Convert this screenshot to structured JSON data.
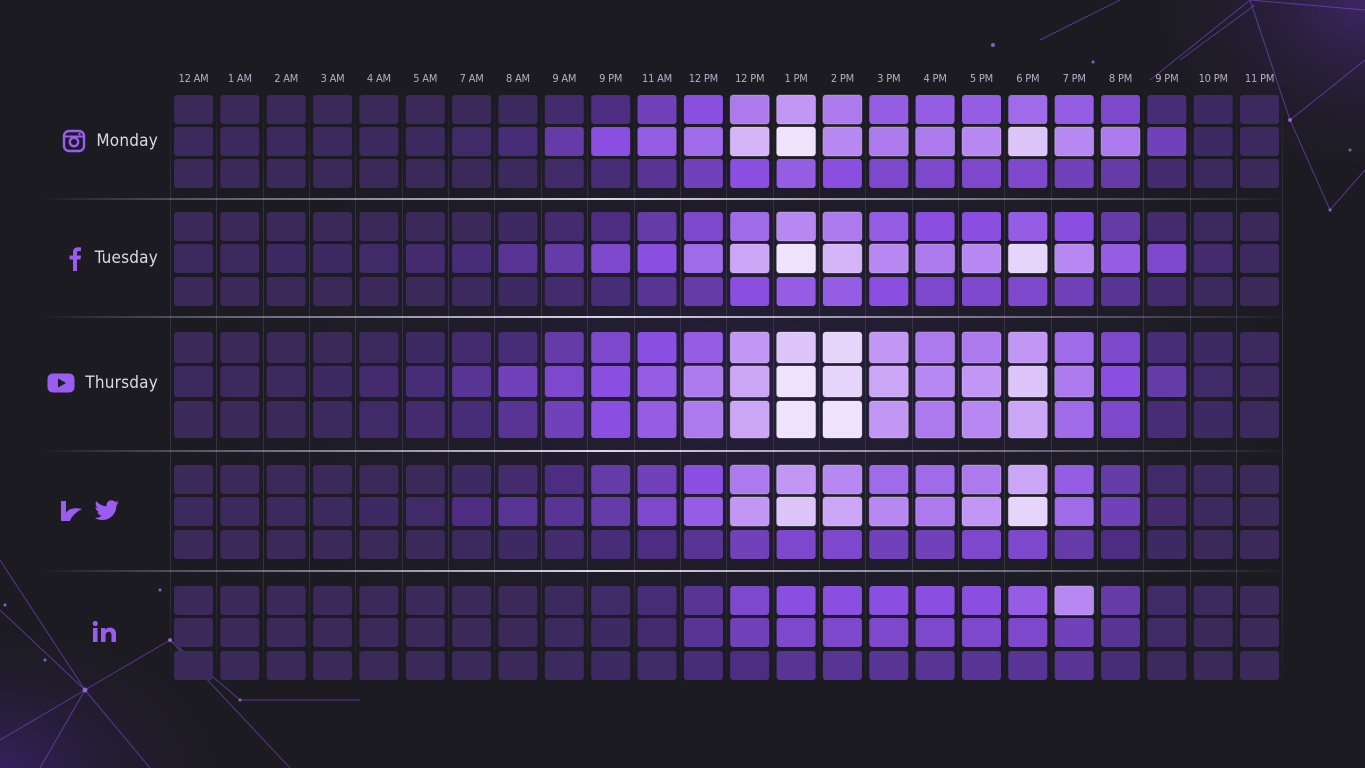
{
  "hours": [
    "12 AM",
    "1 AM",
    "2 AM",
    "3 AM",
    "4 AM",
    "5 AM",
    "7 AM",
    "8 AM",
    "9 AM",
    "9 PM",
    "11 AM",
    "12 PM",
    "12 PM",
    "1 PM",
    "2 PM",
    "3 PM",
    "4 PM",
    "5 PM",
    "6 PM",
    "7 PM",
    "8 PM",
    "9 PM",
    "10 PM",
    "11 PM"
  ],
  "rows": [
    {
      "day": "Monday",
      "icons": [
        "instagram-icon"
      ]
    },
    {
      "day": "Tuesday",
      "icons": [
        "facebook-icon"
      ]
    },
    {
      "day": "Thursday",
      "icons": [
        "youtube-icon"
      ]
    },
    {
      "day": "",
      "icons": [
        "unknown-brand-icon",
        "twitter-icon"
      ]
    },
    {
      "day": "",
      "icons": [
        "linkedin-icon"
      ]
    }
  ],
  "colors": {
    "accent": "#8a4fe0",
    "background": "#1c1b21",
    "cell_low": "#3a2a57",
    "cell_high": "#efe3fb"
  },
  "chart_data": {
    "type": "heatmap",
    "x_categories": [
      "12 AM",
      "1 AM",
      "2 AM",
      "3 AM",
      "4 AM",
      "5 AM",
      "7 AM",
      "8 AM",
      "9 AM",
      "9 PM",
      "11 AM",
      "12 PM",
      "12 PM",
      "1 PM",
      "2 PM",
      "3 PM",
      "4 PM",
      "5 PM",
      "6 PM",
      "7 PM",
      "8 PM",
      "9 PM",
      "10 PM",
      "11 PM"
    ],
    "groups": [
      {
        "label": "Monday",
        "values": [
          [
            0.05,
            0.05,
            0.05,
            0.05,
            0.05,
            0.05,
            0.05,
            0.08,
            0.15,
            0.25,
            0.4,
            0.5,
            0.65,
            0.75,
            0.65,
            0.55,
            0.55,
            0.55,
            0.6,
            0.55,
            0.45,
            0.2,
            0.1,
            0.08
          ],
          [
            0.08,
            0.08,
            0.08,
            0.08,
            0.08,
            0.08,
            0.12,
            0.2,
            0.35,
            0.5,
            0.55,
            0.6,
            0.85,
            1.0,
            0.7,
            0.65,
            0.65,
            0.7,
            0.9,
            0.7,
            0.65,
            0.4,
            0.1,
            0.08
          ],
          [
            0.05,
            0.05,
            0.05,
            0.05,
            0.05,
            0.05,
            0.05,
            0.08,
            0.12,
            0.2,
            0.3,
            0.4,
            0.5,
            0.55,
            0.5,
            0.45,
            0.45,
            0.45,
            0.45,
            0.4,
            0.35,
            0.15,
            0.08,
            0.05
          ]
        ]
      },
      {
        "label": "Tuesday",
        "values": [
          [
            0.05,
            0.05,
            0.05,
            0.05,
            0.05,
            0.05,
            0.05,
            0.1,
            0.15,
            0.25,
            0.35,
            0.45,
            0.6,
            0.7,
            0.65,
            0.55,
            0.5,
            0.5,
            0.55,
            0.5,
            0.35,
            0.15,
            0.08,
            0.05
          ],
          [
            0.08,
            0.08,
            0.1,
            0.1,
            0.12,
            0.15,
            0.2,
            0.3,
            0.35,
            0.45,
            0.5,
            0.6,
            0.8,
            1.0,
            0.85,
            0.7,
            0.65,
            0.7,
            0.95,
            0.7,
            0.55,
            0.45,
            0.15,
            0.08
          ],
          [
            0.05,
            0.05,
            0.05,
            0.05,
            0.05,
            0.05,
            0.08,
            0.1,
            0.15,
            0.2,
            0.3,
            0.35,
            0.5,
            0.55,
            0.55,
            0.5,
            0.45,
            0.45,
            0.45,
            0.4,
            0.3,
            0.15,
            0.08,
            0.05
          ]
        ]
      },
      {
        "label": "Thursday",
        "values": [
          [
            0.05,
            0.05,
            0.05,
            0.05,
            0.08,
            0.1,
            0.15,
            0.2,
            0.35,
            0.45,
            0.5,
            0.55,
            0.75,
            0.9,
            0.95,
            0.75,
            0.65,
            0.65,
            0.75,
            0.6,
            0.45,
            0.2,
            0.1,
            0.08
          ],
          [
            0.08,
            0.08,
            0.08,
            0.1,
            0.15,
            0.2,
            0.3,
            0.4,
            0.45,
            0.5,
            0.55,
            0.65,
            0.8,
            1.0,
            0.95,
            0.8,
            0.7,
            0.75,
            0.9,
            0.65,
            0.5,
            0.35,
            0.12,
            0.08
          ],
          [
            0.05,
            0.05,
            0.05,
            0.08,
            0.12,
            0.15,
            0.2,
            0.3,
            0.4,
            0.5,
            0.55,
            0.65,
            0.8,
            1.0,
            1.0,
            0.75,
            0.65,
            0.7,
            0.8,
            0.6,
            0.45,
            0.2,
            0.1,
            0.08
          ]
        ]
      },
      {
        "label": "",
        "values": [
          [
            0.05,
            0.05,
            0.05,
            0.05,
            0.05,
            0.05,
            0.1,
            0.15,
            0.25,
            0.35,
            0.4,
            0.5,
            0.65,
            0.75,
            0.7,
            0.6,
            0.6,
            0.65,
            0.8,
            0.55,
            0.35,
            0.12,
            0.08,
            0.05
          ],
          [
            0.08,
            0.08,
            0.08,
            0.08,
            0.1,
            0.12,
            0.25,
            0.3,
            0.3,
            0.35,
            0.45,
            0.55,
            0.75,
            0.9,
            0.8,
            0.7,
            0.65,
            0.75,
            0.95,
            0.6,
            0.4,
            0.15,
            0.08,
            0.05
          ],
          [
            0.05,
            0.05,
            0.05,
            0.05,
            0.05,
            0.05,
            0.08,
            0.1,
            0.15,
            0.2,
            0.25,
            0.3,
            0.4,
            0.45,
            0.45,
            0.4,
            0.4,
            0.45,
            0.45,
            0.35,
            0.25,
            0.1,
            0.05,
            0.05
          ]
        ]
      },
      {
        "label": "",
        "values": [
          [
            0.05,
            0.05,
            0.05,
            0.05,
            0.05,
            0.05,
            0.05,
            0.05,
            0.08,
            0.12,
            0.2,
            0.3,
            0.45,
            0.5,
            0.5,
            0.5,
            0.5,
            0.5,
            0.55,
            0.7,
            0.35,
            0.12,
            0.08,
            0.05
          ],
          [
            0.05,
            0.05,
            0.05,
            0.05,
            0.05,
            0.05,
            0.05,
            0.05,
            0.08,
            0.1,
            0.15,
            0.3,
            0.4,
            0.45,
            0.45,
            0.45,
            0.45,
            0.45,
            0.45,
            0.4,
            0.3,
            0.12,
            0.05,
            0.05
          ],
          [
            0.05,
            0.05,
            0.05,
            0.05,
            0.05,
            0.05,
            0.05,
            0.05,
            0.08,
            0.1,
            0.12,
            0.2,
            0.25,
            0.3,
            0.3,
            0.3,
            0.3,
            0.3,
            0.3,
            0.3,
            0.2,
            0.08,
            0.05,
            0.05
          ]
        ]
      }
    ]
  }
}
